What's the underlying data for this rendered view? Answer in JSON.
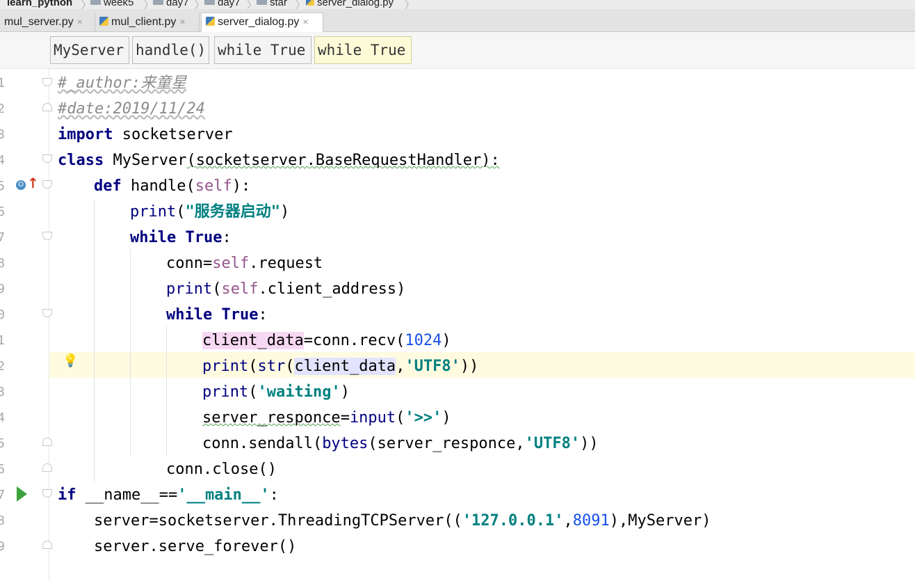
{
  "breadcrumbs": [
    "learn_python",
    "week5",
    "day7",
    "day7",
    "star",
    "server_dialog.py"
  ],
  "tabs": [
    {
      "label": "mul_server.py",
      "active": false,
      "close": "×"
    },
    {
      "label": "mul_client.py",
      "active": false,
      "close": "×"
    },
    {
      "label": "server_dialog.py",
      "active": true,
      "close": "×"
    }
  ],
  "structure_path": [
    "MyServer",
    "handle()",
    "while True",
    "while True"
  ],
  "gutter": {
    "line_numbers": [
      "1",
      "2",
      "3",
      "4",
      "5",
      "6",
      "7",
      "8",
      "9",
      "0",
      "1",
      "2",
      "3",
      "4",
      "5",
      "6",
      "7",
      "8",
      "9"
    ],
    "override_icon_letter": "O",
    "override_arrow": "↑",
    "bulb": "💡"
  },
  "code": {
    "l1_comment": "#_author:来童星",
    "l2_comment": "#date:2019/11/24",
    "l3_kw": "import",
    "l3_rest": " socketserver",
    "l4_kw": "class",
    "l4_name": " MyServer",
    "l4_rest": "(socketserver.BaseRequestHandler):",
    "l5_kw": "def",
    "l5_name": " handle(",
    "l5_self": "self",
    "l5_end": "):",
    "l6_print": "print",
    "l6_open": "(",
    "l6_str": "\"服务器启动\"",
    "l6_close": ")",
    "l7_kw": "while True",
    "l7_colon": ":",
    "l8_var": "conn=",
    "l8_self": "self",
    "l8_rest": ".request",
    "l9_print": "print",
    "l9_open": "(",
    "l9_self": "self",
    "l9_rest": ".client_address)",
    "l10_kw": "while True",
    "l10_colon": ":",
    "l11_var": "client_data",
    "l11_mid": "=conn.recv(",
    "l11_num": "1024",
    "l11_end": ")",
    "l12_print": "print",
    "l12_open": "(",
    "l12_str_fn": "str",
    "l12_open2": "(",
    "l12_var": "client_data",
    "l12_comma": ",",
    "l12_str": "'UTF8'",
    "l12_end": "))",
    "l13_print": "print",
    "l13_open": "(",
    "l13_str": "'waiting'",
    "l13_end": ")",
    "l14_var": "server_responce",
    "l14_eq": "=",
    "l14_input": "input",
    "l14_open": "(",
    "l14_str": "'>>'",
    "l14_end": ")",
    "l15_pre": "conn.sendall(",
    "l15_bytes": "bytes",
    "l15_mid": "(server_responce",
    "l15_comma": ",",
    "l15_str": "'UTF8'",
    "l15_end": "))",
    "l16_text": "conn.close()",
    "l17_kw": "if",
    "l17_mid": " __name__==",
    "l17_str": "'__main__'",
    "l17_end": ":",
    "l18_pre": "server=socketserver.ThreadingTCPServer((",
    "l18_str": "'127.0.0.1'",
    "l18_comma": ",",
    "l18_num": "8091",
    "l18_end": "),MyServer)",
    "l19_text": "server.serve_forever()"
  },
  "colors": {
    "keyword": "#000080",
    "string": "#008080",
    "number": "#1750eb",
    "comment": "#8c8c8c",
    "self": "#94558d",
    "current_line": "#fffbe0"
  }
}
